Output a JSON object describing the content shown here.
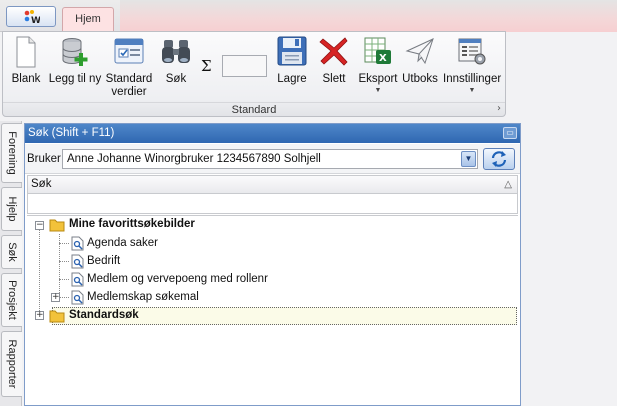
{
  "app": {
    "logo_icon": "app-logo-icon"
  },
  "tabs": [
    {
      "label": "Hjem",
      "active": true
    }
  ],
  "ribbon": {
    "group_label": "Standard",
    "buttons": [
      {
        "label": "Blank",
        "icon": "blank-document-icon"
      },
      {
        "label": "Legg til ny",
        "icon": "add-database-icon"
      },
      {
        "label": "Standard",
        "label2": "verdier",
        "icon": "default-values-icon"
      },
      {
        "label": "Søk",
        "icon": "binoculars-icon"
      },
      {
        "label": "Lagre",
        "icon": "floppy-save-icon"
      },
      {
        "label": "Slett",
        "icon": "delete-x-icon"
      },
      {
        "label": "Eksport",
        "icon": "excel-export-icon",
        "has_dropdown": true
      },
      {
        "label": "Utboks",
        "icon": "paper-plane-icon"
      },
      {
        "label": "Innstillinger",
        "icon": "settings-icon",
        "has_dropdown": true
      }
    ],
    "sum_symbol": "Σ",
    "sum_value": ""
  },
  "side_tabs": [
    "Forening",
    "Hjelp",
    "Søk",
    "Prosjekt",
    "Rapporter"
  ],
  "panel": {
    "title": "Søk (Shift + F11)",
    "bruker_label": "Bruker",
    "bruker_value": "Anne Johanne Winorgbruker 1234567890 Solhjell",
    "search_header": "Søk",
    "search_value": ""
  },
  "tree": {
    "groups": [
      {
        "label": "Mine favorittsøkebilder",
        "expanded": true,
        "children": [
          {
            "label": "Agenda saker",
            "expandable": false
          },
          {
            "label": "Bedrift",
            "expandable": false
          },
          {
            "label": "Medlem og vervepoeng med rollenr",
            "expandable": false
          },
          {
            "label": "Medlemskap søkemal",
            "expandable": true
          }
        ]
      },
      {
        "label": "Standardsøk",
        "expanded": false,
        "selected": true
      }
    ]
  },
  "colors": {
    "panel_title_bg": "#3a72ba",
    "ribbon_tab_bg": "#fde2e3",
    "selected_row_bg": "#fbfbe8"
  }
}
